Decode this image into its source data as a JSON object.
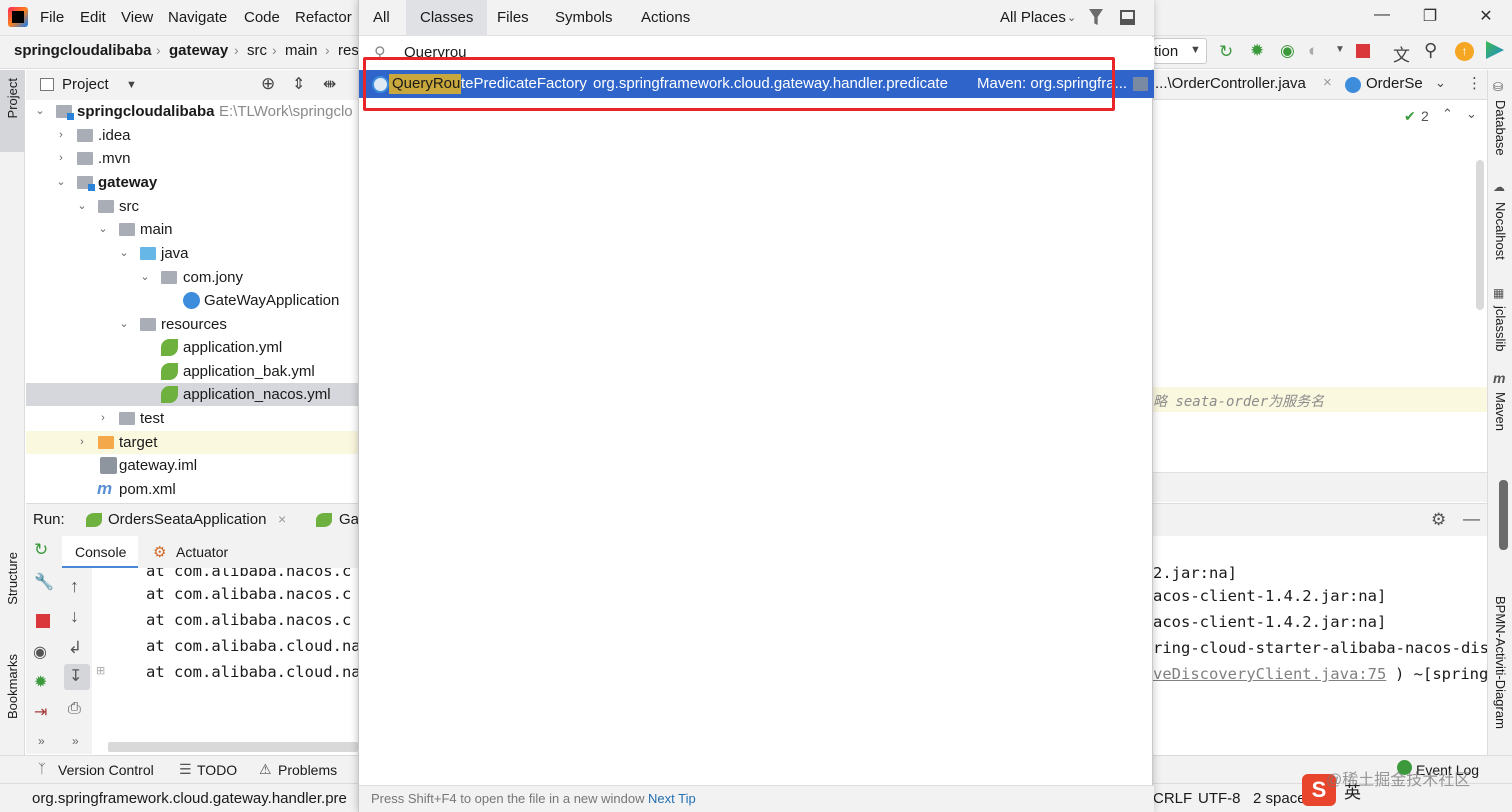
{
  "menu": {
    "items": [
      "File",
      "Edit",
      "View",
      "Navigate",
      "Code",
      "Refactor"
    ]
  },
  "breadcrumb": [
    "springcloudalibaba",
    "gateway",
    "src",
    "main",
    "res"
  ],
  "project_panel": {
    "title": "Project",
    "root": {
      "name": "springcloudalibaba",
      "path": "E:\\TLWork\\springclo"
    },
    "items": [
      {
        "label": ".idea"
      },
      {
        "label": ".mvn"
      },
      {
        "label": "gateway"
      },
      {
        "label": "src"
      },
      {
        "label": "main"
      },
      {
        "label": "java"
      },
      {
        "label": "com.jony"
      },
      {
        "label": "GateWayApplication"
      },
      {
        "label": "resources"
      },
      {
        "label": "application.yml"
      },
      {
        "label": "application_bak.yml"
      },
      {
        "label": "application_nacos.yml"
      },
      {
        "label": "test"
      },
      {
        "label": "target"
      },
      {
        "label": "gateway.iml"
      },
      {
        "label": "pom.xml"
      }
    ]
  },
  "run_panel": {
    "label": "Run:",
    "tab1": "OrdersSeataApplication",
    "tab2": "Ga",
    "console_tab": "Console",
    "actuator_tab": "Actuator",
    "lines": [
      "at com.alibaba.nacos.c",
      "at com.alibaba.nacos.c",
      "at com.alibaba.nacos.c",
      "at com.alibaba.cloud.na",
      "at com.alibaba.cloud.na"
    ],
    "right_lines": [
      "2.jar:na]",
      "acos-client-1.4.2.jar:na]",
      "acos-client-1.4.2.jar:na]",
      "ring-cloud-starter-alibaba-nacos-dis",
      "veDiscoveryClient.java:75",
      ") ~[spring"
    ]
  },
  "search_popup": {
    "tabs": [
      "All",
      "Classes",
      "Files",
      "Symbols",
      "Actions"
    ],
    "active_tab": "Classes",
    "scope": "All Places",
    "query": "Queryrou",
    "result": {
      "match": "QueryRou",
      "rest": "tePredicateFactory",
      "package": "org.springframework.cloud.gateway.handler.predicate",
      "location": "Maven: org.springfra..."
    },
    "footer_tip": "Press Shift+F4 to open the file in a new window",
    "footer_link": "Next Tip"
  },
  "right_area": {
    "run_config": "tion",
    "editor_tab1": "...\\OrderController.java",
    "editor_tab2": "OrderSe",
    "inspections": "2",
    "comment": "略 seata-order为服务名",
    "side_tools": [
      "Database",
      "Nocalhost",
      "jclasslib",
      "Maven",
      "BPMN-Activiti-Diagram"
    ]
  },
  "left_tools": [
    "Project",
    "Structure",
    "Bookmarks"
  ],
  "bottom_tools": [
    "Version Control",
    "TODO",
    "Problems",
    "Event Log"
  ],
  "status": {
    "path": "org.springframework.cloud.gateway.handler.pre",
    "line_sep": "CRLF",
    "encoding": "UTF-8",
    "indent": "2 space",
    "ime": "英",
    "watermark": "@稀土掘金技术社区"
  }
}
